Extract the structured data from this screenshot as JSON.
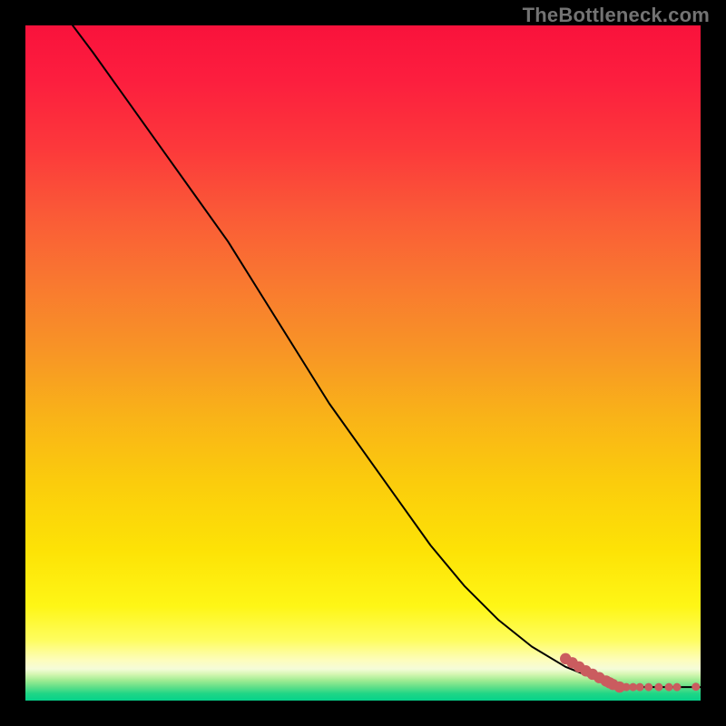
{
  "watermark": "TheBottleneck.com",
  "colors": {
    "background": "#000000",
    "curve": "#000000",
    "marker": "#ca5c5f",
    "gradient_top": "#f9123c",
    "gradient_mid": "#fbcd0c",
    "gradient_bottom": "#06d28a"
  },
  "chart_data": {
    "type": "line",
    "title": "",
    "xlabel": "",
    "ylabel": "",
    "xlim": [
      0,
      100
    ],
    "ylim": [
      0,
      100
    ],
    "grid": false,
    "legend": false,
    "curve": {
      "x": [
        7,
        10,
        15,
        20,
        25,
        30,
        35,
        40,
        45,
        50,
        55,
        60,
        65,
        70,
        75,
        80,
        85,
        88,
        90,
        92,
        94,
        96,
        98,
        100
      ],
      "y": [
        100,
        96,
        89,
        82,
        75,
        68,
        60,
        52,
        44,
        37,
        30,
        23,
        17,
        12,
        8,
        5,
        3,
        2,
        2,
        2,
        2,
        2,
        2,
        2
      ]
    },
    "markers": {
      "x": [
        80,
        81,
        82,
        83,
        84,
        85,
        86,
        86.5,
        87,
        88,
        89,
        90,
        91,
        92.3,
        93.8,
        95.3,
        96.5,
        99.3
      ],
      "y": [
        6.2,
        5.6,
        5.0,
        4.4,
        3.9,
        3.4,
        2.9,
        2.65,
        2.4,
        2.0,
        2.0,
        2.0,
        2.0,
        2.0,
        2.0,
        2.0,
        2.0,
        2.05
      ]
    }
  }
}
